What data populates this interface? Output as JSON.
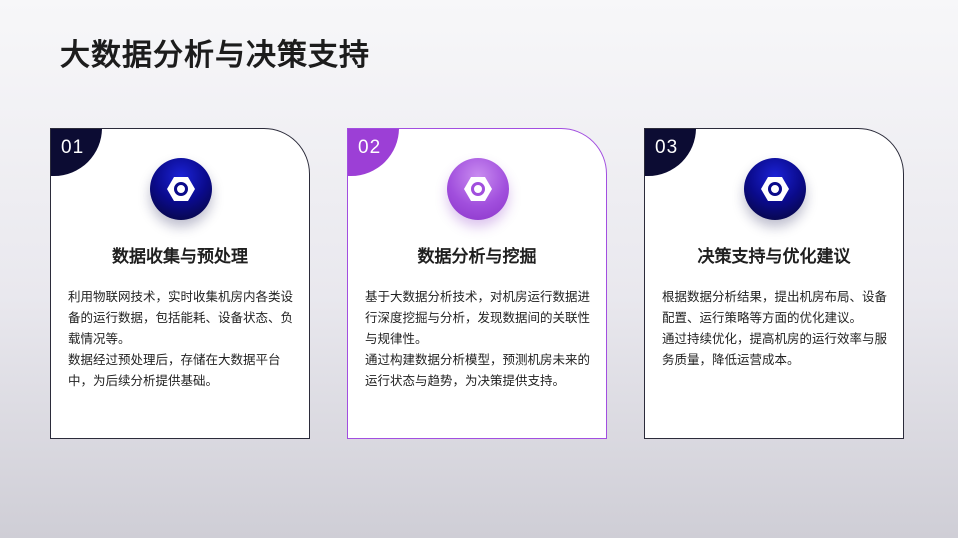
{
  "title": "大数据分析与决策支持",
  "cards": [
    {
      "number": "01",
      "icon": "hex-nut-icon",
      "heading": "数据收集与预处理",
      "paragraphs": [
        "利用物联网技术，实时收集机房内各类设备的运行数据，包括能耗、设备状态、负载情况等。",
        "数据经过预处理后，存储在大数据平台中，为后续分析提供基础。"
      ]
    },
    {
      "number": "02",
      "icon": "hex-nut-icon",
      "heading": "数据分析与挖掘",
      "paragraphs": [
        "基于大数据分析技术，对机房运行数据进行深度挖掘与分析，发现数据间的关联性与规律性。",
        "通过构建数据分析模型，预测机房未来的运行状态与趋势，为决策提供支持。"
      ]
    },
    {
      "number": "03",
      "icon": "hex-nut-icon",
      "heading": "决策支持与优化建议",
      "paragraphs": [
        "根据数据分析结果，提出机房布局、设备配置、运行策略等方面的优化建议。",
        "通过持续优化，提高机房的运行效率与服务质量，降低运营成本。"
      ]
    }
  ],
  "colors": {
    "dark": "#0c0c33",
    "accent": "#9c3fd6"
  }
}
